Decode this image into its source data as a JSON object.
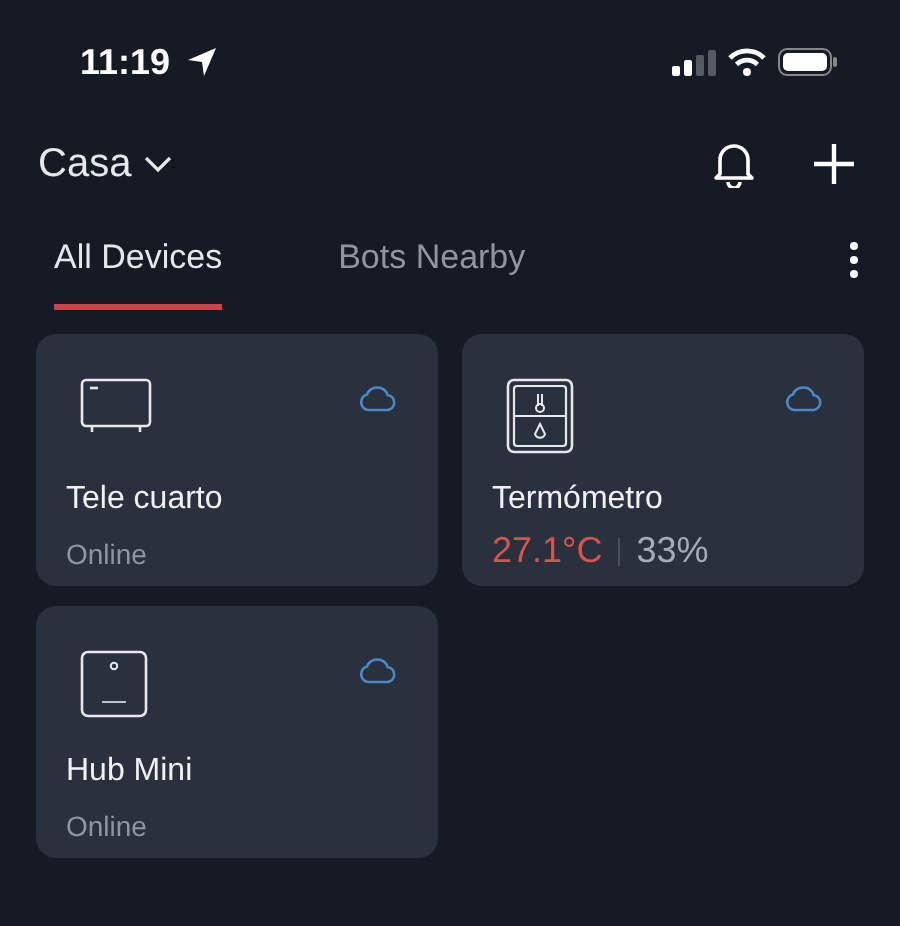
{
  "status_bar": {
    "time": "11:19"
  },
  "header": {
    "home": "Casa"
  },
  "tabs": [
    {
      "label": "All Devices",
      "selected": true
    },
    {
      "label": "Bots Nearby",
      "selected": false
    }
  ],
  "devices": [
    {
      "kind": "tv",
      "name": "Tele cuarto",
      "status": "Online"
    },
    {
      "kind": "meter",
      "name": "Termómetro",
      "temperature": "27.1°C",
      "humidity": "33%"
    },
    {
      "kind": "hub",
      "name": "Hub Mini",
      "status": "Online"
    }
  ]
}
